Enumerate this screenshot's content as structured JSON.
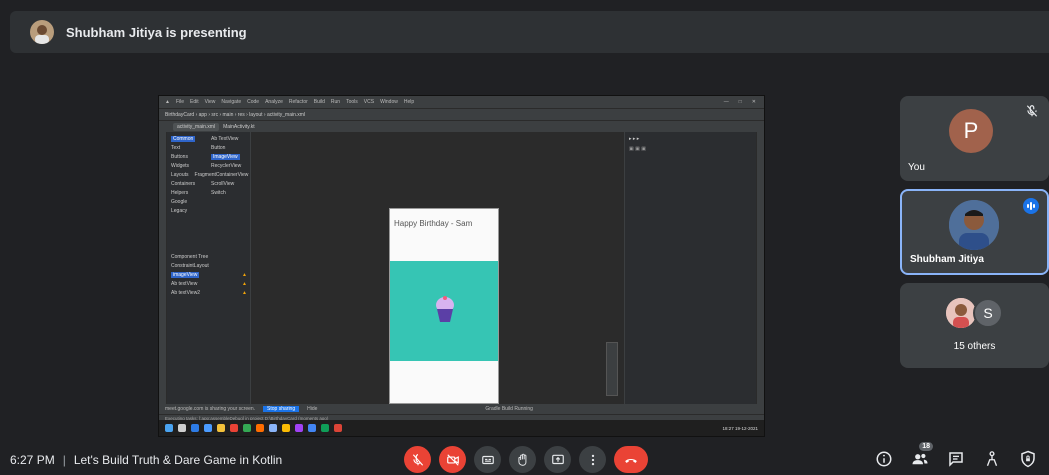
{
  "presenting_banner": {
    "text": "Shubham Jitiya is presenting"
  },
  "shared_screen": {
    "ide": {
      "project_breadcrumb": "BirthdayCard › app › src › main › res › layout › activity_main.xml",
      "tabs": [
        "activity_main.xml",
        "MainActivity.kt"
      ],
      "palette_categories": [
        "Common",
        "Text",
        "Buttons",
        "Widgets",
        "Layouts",
        "Containers",
        "Helpers",
        "Google",
        "Legacy"
      ],
      "palette_items": [
        "Ab TextView",
        "Button",
        "ImageView",
        "RecyclerView",
        "FragmentContainerView",
        "ScrollView",
        "Switch"
      ],
      "component_tree_title": "Component Tree",
      "component_tree": [
        "ConstraintLayout",
        "imageView",
        "Ab textView",
        "Ab textView2"
      ],
      "preview_text": "Happy Birthday - Sam",
      "status_share": "Stop sharing",
      "status_hide": "Hide",
      "status_message": "meet.google.com is sharing your screen.",
      "build_status": "Gradle Build Running",
      "status_line2": "Executing tasks: [:app:assembleDebug] in project D:\\BirthdayCard (moments ago)",
      "tray_time": "18:27",
      "tray_date": "19-12-2021"
    }
  },
  "participants": {
    "you": {
      "initial": "P",
      "label": "You"
    },
    "speaker": {
      "label": "Shubham Jitiya"
    },
    "others": {
      "initial": "S",
      "label": "15 others"
    }
  },
  "bottom_bar": {
    "time": "6:27 PM",
    "separator": "|",
    "meeting_title": "Let's Build Truth & Dare Game in Kotlin",
    "people_count": "18"
  },
  "colors": {
    "background": "#202124",
    "tile": "#3c4043",
    "danger": "#ea4335",
    "accent": "#1a73e8"
  }
}
